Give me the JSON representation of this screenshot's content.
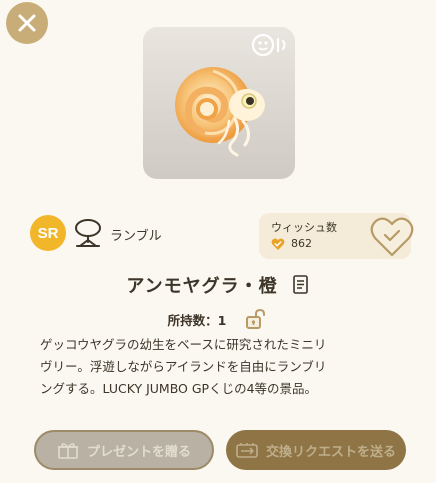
{
  "card": {
    "rarity": "SR",
    "type_label": "ランブル"
  },
  "wish": {
    "label": "ウィッシュ数",
    "count": "862"
  },
  "item": {
    "title": "アンモヤグラ・橙",
    "owned_label": "所持数：1",
    "description": "ゲッコウヤグラの幼生をベースに研究されたミニリ\nヴリー。浮遊しながらアイランドを自由にランブリ\nングする。LUCKY JUMBO GPくじの4等の景品。"
  },
  "actions": {
    "present_label": "プレゼントを贈る",
    "exchange_label": "交換リクエストを送る"
  },
  "icons": {
    "close": "close-icon",
    "badge": "face-sound-icon",
    "type": "rumble-type-icon",
    "wish": "heart-check-icon",
    "doc": "document-icon",
    "lock": "lock-icon",
    "gift": "gift-icon",
    "exchange": "exchange-icon"
  },
  "colors": {
    "accent_gold": "#c9ad78",
    "sr_yellow": "#f2b62a",
    "wish_heart": "#e9a328",
    "button_brown": "#8f7546"
  }
}
